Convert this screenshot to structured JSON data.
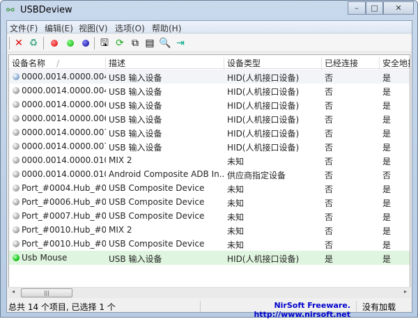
{
  "window": {
    "title": "USBDeview",
    "app_icon": "usb-icon",
    "controls": [
      "minimize",
      "maximize",
      "close"
    ]
  },
  "menu": [
    "文件(F)",
    "编辑(E)",
    "视图(V)",
    "选项(O)",
    "帮助(H)"
  ],
  "toolbar": [
    "close-x-icon",
    "uninstall-icon",
    "red-dot-icon",
    "green-dot-icon",
    "blue-dot-icon",
    "save-icon",
    "refresh-icon",
    "copy-icon",
    "properties-icon",
    "find-icon",
    "exit-icon"
  ],
  "columns": [
    "设备名称",
    "描述",
    "设备类型",
    "已经连接",
    "安全地拔"
  ],
  "rows": [
    {
      "name": "0000.0014.0000.004....",
      "desc": "USB 输入设备",
      "type": "HID(人机接口设备)",
      "connected": "否",
      "safe": "是",
      "state": "current"
    },
    {
      "name": "0000.0014.0000.004....",
      "desc": "USB 输入设备",
      "type": "HID(人机接口设备)",
      "connected": "否",
      "safe": "是",
      "state": "off"
    },
    {
      "name": "0000.0014.0000.006....",
      "desc": "USB 输入设备",
      "type": "HID(人机接口设备)",
      "connected": "否",
      "safe": "是",
      "state": "off"
    },
    {
      "name": "0000.0014.0000.006....",
      "desc": "USB 输入设备",
      "type": "HID(人机接口设备)",
      "connected": "否",
      "safe": "是",
      "state": "off"
    },
    {
      "name": "0000.0014.0000.007....",
      "desc": "USB 输入设备",
      "type": "HID(人机接口设备)",
      "connected": "否",
      "safe": "是",
      "state": "off"
    },
    {
      "name": "0000.0014.0000.007....",
      "desc": "USB 输入设备",
      "type": "HID(人机接口设备)",
      "connected": "否",
      "safe": "是",
      "state": "off"
    },
    {
      "name": "0000.0014.0000.010....",
      "desc": "MIX 2",
      "type": "未知",
      "connected": "否",
      "safe": "是",
      "state": "off"
    },
    {
      "name": "0000.0014.0000.010....",
      "desc": "Android Composite ADB In...",
      "type": "供应商指定设备",
      "connected": "否",
      "safe": "否",
      "state": "off"
    },
    {
      "name": "Port_#0004.Hub_#0...",
      "desc": "USB Composite Device",
      "type": "未知",
      "connected": "否",
      "safe": "是",
      "state": "off"
    },
    {
      "name": "Port_#0006.Hub_#0...",
      "desc": "USB Composite Device",
      "type": "未知",
      "connected": "否",
      "safe": "是",
      "state": "off"
    },
    {
      "name": "Port_#0007.Hub_#0...",
      "desc": "USB Composite Device",
      "type": "未知",
      "connected": "否",
      "safe": "是",
      "state": "off"
    },
    {
      "name": "Port_#0010.Hub_#0...",
      "desc": "MIX 2",
      "type": "未知",
      "connected": "否",
      "safe": "是",
      "state": "off"
    },
    {
      "name": "Port_#0010.Hub_#0...",
      "desc": "USB Composite Device",
      "type": "未知",
      "connected": "否",
      "safe": "是",
      "state": "off"
    },
    {
      "name": "Usb Mouse",
      "desc": "USB 输入设备",
      "type": "HID(人机接口设备)",
      "connected": "是",
      "safe": "是",
      "state": "on"
    }
  ],
  "status": {
    "count": "总共 14 个项目, 已选择 1 个",
    "credit": "NirSoft Freeware.  http://www.nirsoft.net",
    "plugin": "没有加载"
  },
  "colors": {
    "link": "#0000cc",
    "selected_row": "#e0f5e0"
  }
}
